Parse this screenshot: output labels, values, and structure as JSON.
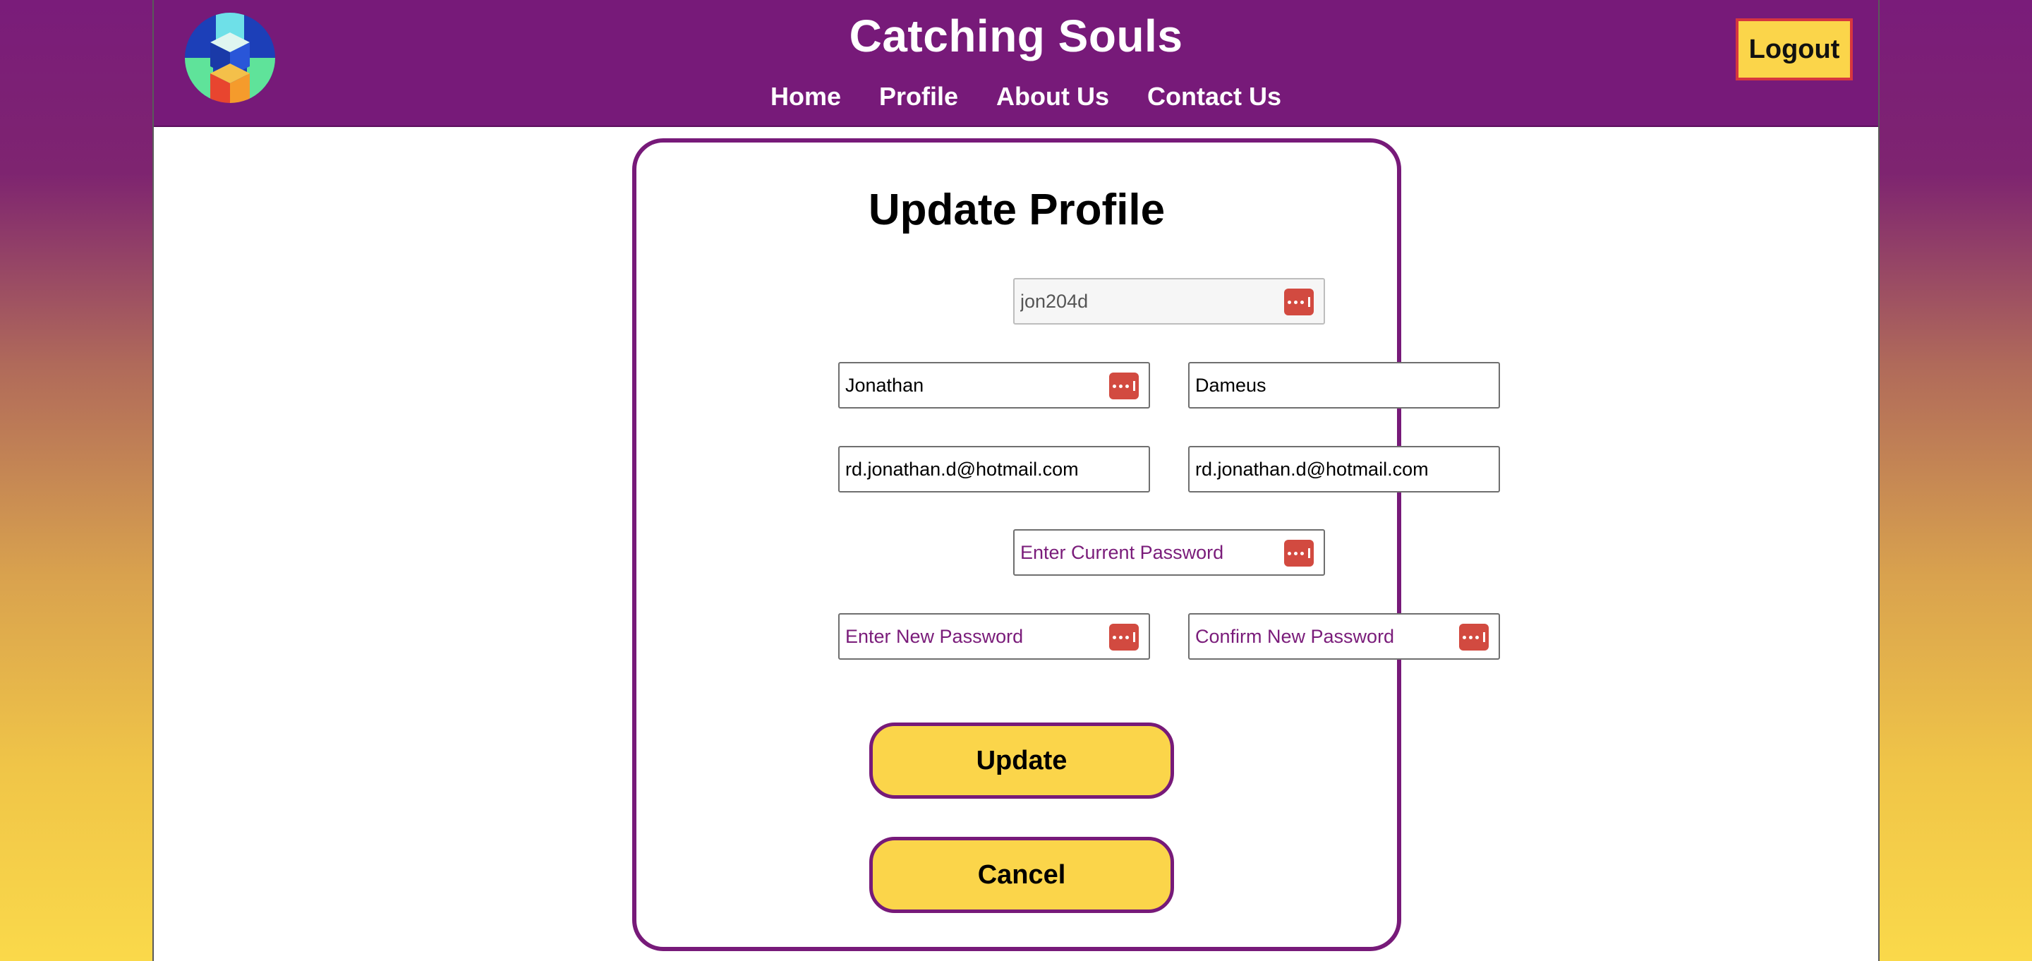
{
  "header": {
    "site_title": "Catching Souls",
    "nav": [
      "Home",
      "Profile",
      "About Us",
      "Contact Us"
    ],
    "logout_label": "Logout"
  },
  "form": {
    "title": "Update Profile",
    "username": "jon204d",
    "first_name": "Jonathan",
    "last_name": "Dameus",
    "email": "rd.jonathan.d@hotmail.com",
    "confirm_email": "rd.jonathan.d@hotmail.com",
    "current_password_placeholder": "Enter Current Password",
    "new_password_placeholder": "Enter New Password",
    "confirm_password_placeholder": "Confirm New Password",
    "update_label": "Update",
    "cancel_label": "Cancel"
  },
  "icons": {
    "logo": "catching-souls-logo-icon",
    "password_manager": "password-manager-key-icon"
  },
  "colors": {
    "brand_purple": "#771a79",
    "button_yellow": "#fbd54a",
    "logout_border": "#d6363f",
    "autofill_icon": "#d24a40"
  }
}
